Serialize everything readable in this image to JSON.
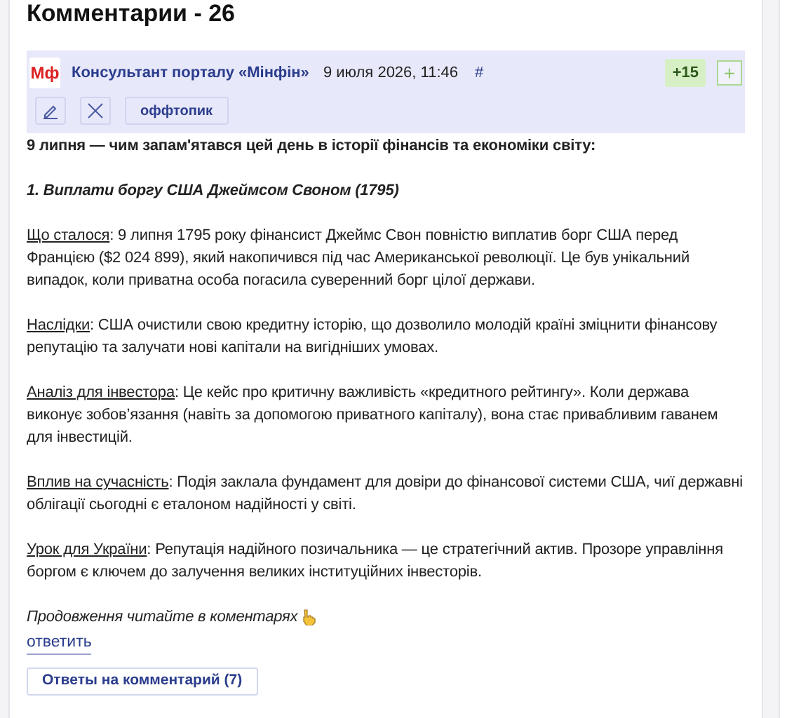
{
  "section_title": "Комментарии - 26",
  "comment": {
    "logo": "Мф",
    "author": "Консультант порталу «Мінфін»",
    "date": "9 июля 2026, 11:46",
    "anchor": "#",
    "score": "+15",
    "vote_button": "+",
    "offtopic_button": "оффтопик",
    "heading": "9 липня — чим запам'ятався цей день в історії фінансів та економіки світу:",
    "subheading": "1. Виплати боргу США Джеймсом Своном (1795)",
    "paragraphs": [
      {
        "label": "Що сталося",
        "text": ": 9 липня 1795 року фінансист Джеймс Свон повністю виплатив борг США перед Францією ($2 024 899), який накопичився під час Американської революції. Це був унікальний випадок, коли приватна особа погасила суверенний борг цілої держави."
      },
      {
        "label": "Наслідки",
        "text": ": США очистили свою кредитну історію, що дозволило молодій країні зміцнити фінансову репутацію та залучати нові капітали на вигідніших умовах."
      },
      {
        "label": "Аналіз для інвестора",
        "text": ": Це кейс про критичну важливість «кредитного рейтингу». Коли держава виконує зобов’язання (навіть за допомогою приватного капіталу), вона стає привабливим гаванем для інвестицій."
      },
      {
        "label": "Вплив на сучасність",
        "text": ": Подія заклала фундамент для довіри до фінансової системи США, чиї державні облігації сьогодні є еталоном надійності у світі."
      },
      {
        "label": "Урок для України",
        "text": ": Репутація надійного позичальника — це стратегічний актив. Прозоре управління боргом є ключем до залучення великих інституційних інвесторів."
      }
    ],
    "continuation": "Продовження читайте в коментарях",
    "reply_link": "ответить",
    "replies_button": "Ответы на комментарий (7)"
  }
}
